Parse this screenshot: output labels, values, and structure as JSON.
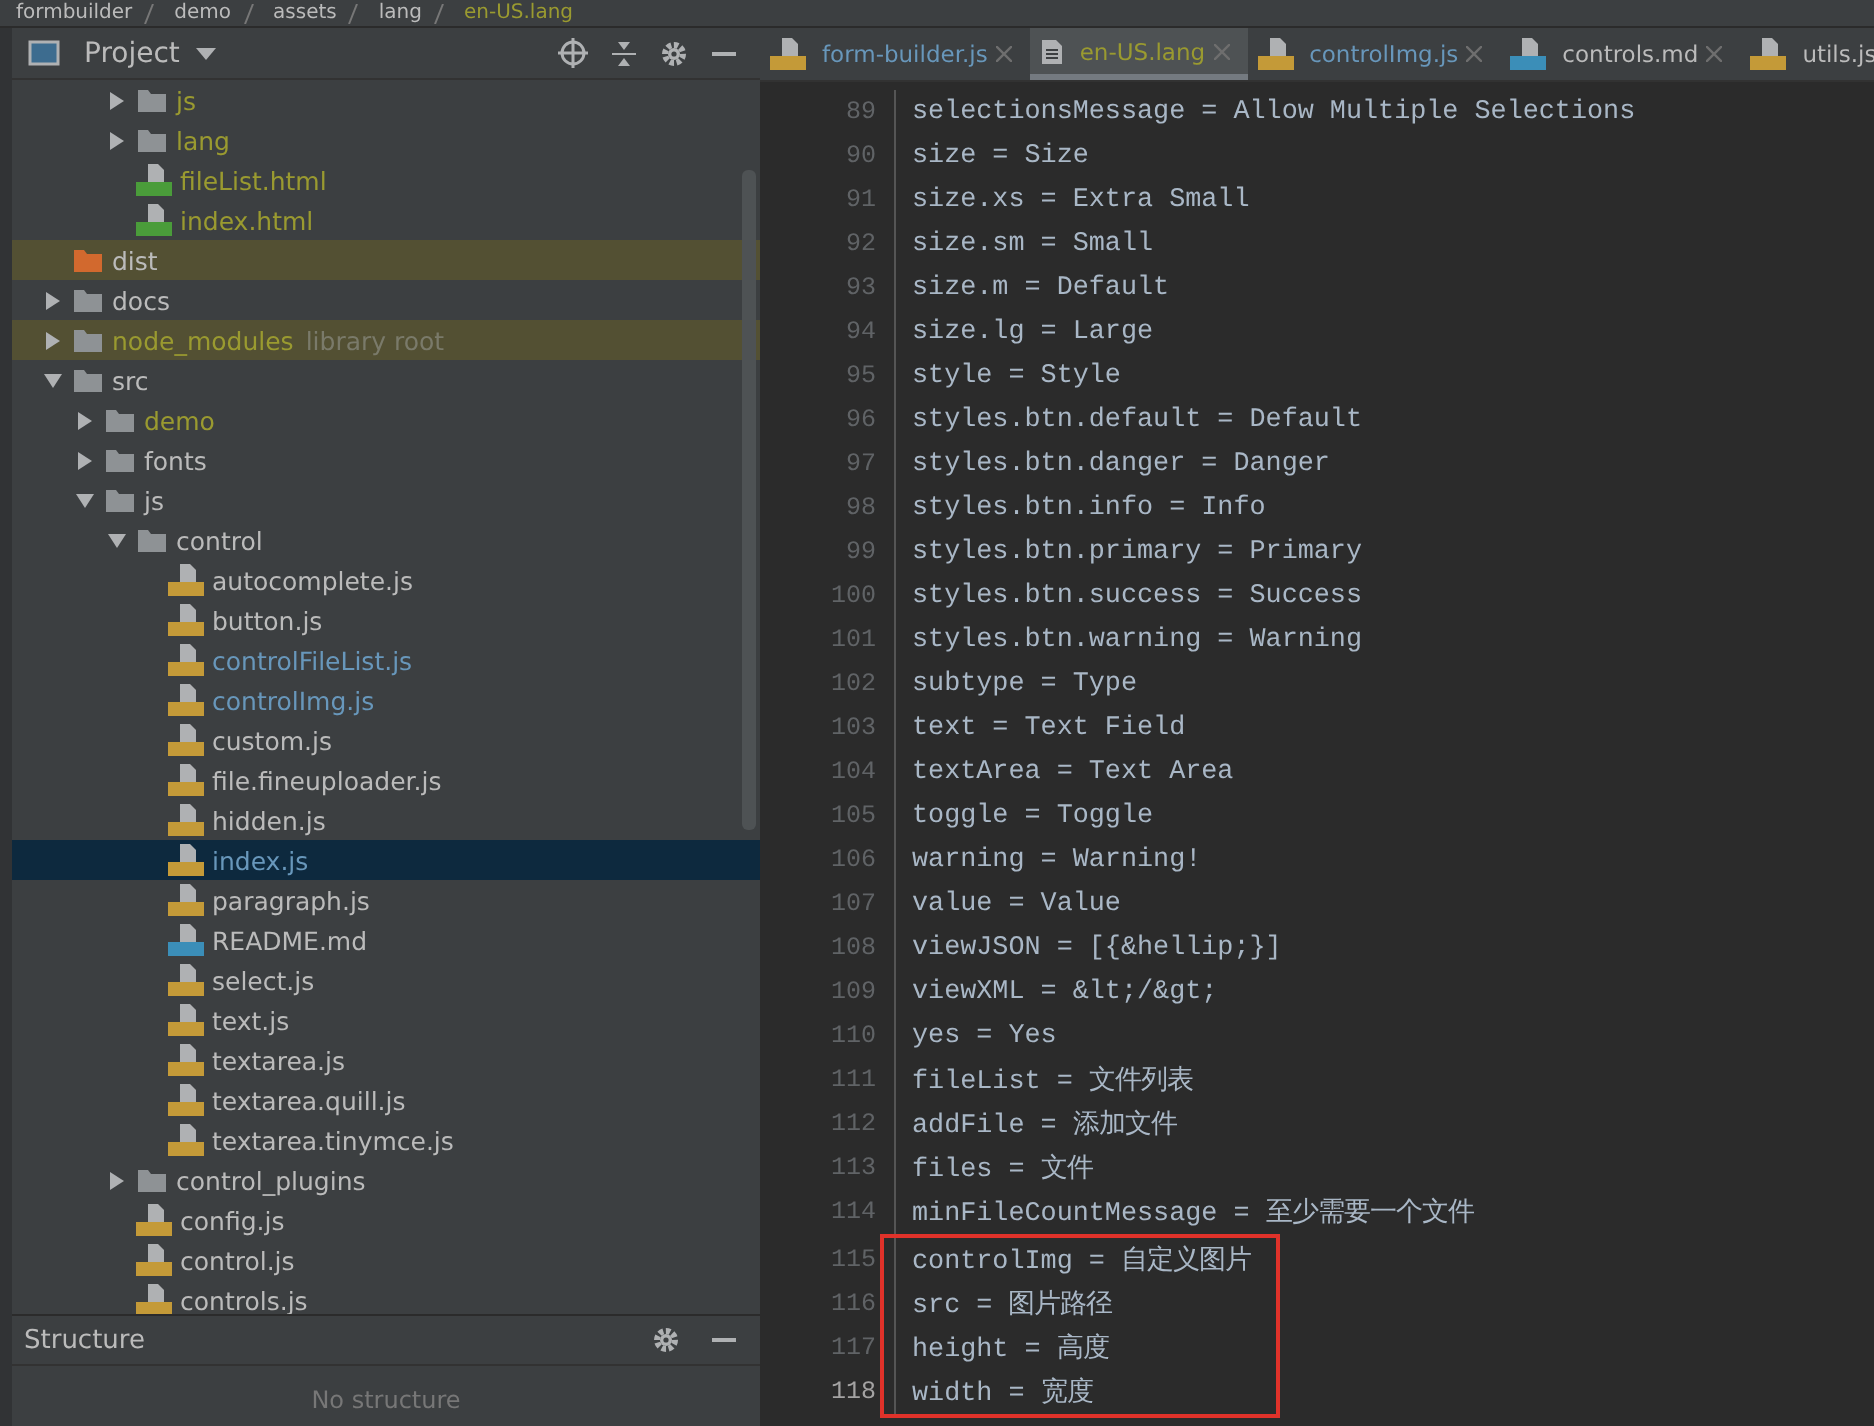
{
  "breadcrumb": [
    "formbuilder",
    "demo",
    "assets",
    "lang",
    "en-US.lang"
  ],
  "project_panel": {
    "title": "Project",
    "tree": {
      "continued_items": [
        {
          "name": "js",
          "kind": "folder",
          "ignored": true,
          "modified": false,
          "excluded": false,
          "expanded": false,
          "selected": false
        },
        {
          "name": "lang",
          "kind": "folder",
          "ignored": true,
          "modified": false,
          "excluded": false,
          "expanded": false,
          "selected": false
        },
        {
          "name": "fileList.html",
          "kind": "html",
          "ignored": true,
          "modified": false,
          "excluded": false,
          "selected": false
        },
        {
          "name": "index.html",
          "kind": "html",
          "ignored": true,
          "modified": false,
          "excluded": false,
          "selected": false
        }
      ],
      "items": [
        {
          "name": "dist",
          "kind": "folder",
          "ignored": false,
          "modified": false,
          "excluded": true,
          "selected": false
        },
        {
          "name": "docs",
          "kind": "folder",
          "ignored": false,
          "modified": false,
          "excluded": false,
          "expanded": false,
          "selected": false
        },
        {
          "name": "node_modules",
          "suffix": "library root",
          "kind": "folder",
          "ignored": true,
          "modified": false,
          "excluded": true,
          "expanded": false,
          "selected": false
        },
        {
          "name": "src",
          "kind": "folder",
          "ignored": false,
          "modified": false,
          "excluded": false,
          "expanded": true,
          "selected": false,
          "children": [
            {
              "name": "demo",
              "kind": "folder",
              "ignored": true,
              "modified": false,
              "excluded": false,
              "expanded": false,
              "selected": false
            },
            {
              "name": "fonts",
              "kind": "folder",
              "ignored": false,
              "modified": false,
              "excluded": false,
              "expanded": false,
              "selected": false
            },
            {
              "name": "js",
              "kind": "folder",
              "ignored": false,
              "modified": false,
              "excluded": false,
              "expanded": true,
              "selected": false,
              "children": [
                {
                  "name": "control",
                  "kind": "folder",
                  "ignored": false,
                  "modified": false,
                  "excluded": false,
                  "expanded": true,
                  "selected": false,
                  "children": [
                    {
                      "name": "autocomplete.js",
                      "kind": "js",
                      "ignored": false,
                      "modified": false,
                      "excluded": false,
                      "selected": false
                    },
                    {
                      "name": "button.js",
                      "kind": "js",
                      "ignored": false,
                      "modified": false,
                      "excluded": false,
                      "selected": false
                    },
                    {
                      "name": "controlFileList.js",
                      "kind": "js",
                      "ignored": false,
                      "modified": true,
                      "excluded": false,
                      "selected": false
                    },
                    {
                      "name": "controlImg.js",
                      "kind": "js",
                      "ignored": false,
                      "modified": true,
                      "excluded": false,
                      "selected": false
                    },
                    {
                      "name": "custom.js",
                      "kind": "js",
                      "ignored": false,
                      "modified": false,
                      "excluded": false,
                      "selected": false
                    },
                    {
                      "name": "file.fineuploader.js",
                      "kind": "js",
                      "ignored": false,
                      "modified": false,
                      "excluded": false,
                      "selected": false
                    },
                    {
                      "name": "hidden.js",
                      "kind": "js",
                      "ignored": false,
                      "modified": false,
                      "excluded": false,
                      "selected": false
                    },
                    {
                      "name": "index.js",
                      "kind": "js",
                      "ignored": false,
                      "modified": true,
                      "excluded": false,
                      "selected": true
                    },
                    {
                      "name": "paragraph.js",
                      "kind": "js",
                      "ignored": false,
                      "modified": false,
                      "excluded": false,
                      "selected": false
                    },
                    {
                      "name": "README.md",
                      "kind": "md",
                      "ignored": false,
                      "modified": false,
                      "excluded": false,
                      "selected": false
                    },
                    {
                      "name": "select.js",
                      "kind": "js",
                      "ignored": false,
                      "modified": false,
                      "excluded": false,
                      "selected": false
                    },
                    {
                      "name": "text.js",
                      "kind": "js",
                      "ignored": false,
                      "modified": false,
                      "excluded": false,
                      "selected": false
                    },
                    {
                      "name": "textarea.js",
                      "kind": "js",
                      "ignored": false,
                      "modified": false,
                      "excluded": false,
                      "selected": false
                    },
                    {
                      "name": "textarea.quill.js",
                      "kind": "js",
                      "ignored": false,
                      "modified": false,
                      "excluded": false,
                      "selected": false
                    },
                    {
                      "name": "textarea.tinymce.js",
                      "kind": "js",
                      "ignored": false,
                      "modified": false,
                      "excluded": false,
                      "selected": false
                    }
                  ]
                },
                {
                  "name": "control_plugins",
                  "kind": "folder",
                  "ignored": false,
                  "modified": false,
                  "excluded": false,
                  "expanded": false,
                  "selected": false
                },
                {
                  "name": "config.js",
                  "kind": "js",
                  "ignored": false,
                  "modified": false,
                  "excluded": false,
                  "selected": false
                },
                {
                  "name": "control.js",
                  "kind": "js",
                  "ignored": false,
                  "modified": false,
                  "excluded": false,
                  "selected": false
                },
                {
                  "name": "controls.js",
                  "kind": "js",
                  "ignored": false,
                  "modified": false,
                  "excluded": false,
                  "selected": false
                }
              ]
            }
          ]
        }
      ]
    }
  },
  "structure_panel": {
    "title": "Structure",
    "message": "No structure"
  },
  "tabs": [
    {
      "label": "form-builder.js",
      "kind": "js",
      "ignored": false,
      "modified": true,
      "selected": false
    },
    {
      "label": "en-US.lang",
      "kind": "text",
      "ignored": true,
      "modified": false,
      "selected": true
    },
    {
      "label": "controlImg.js",
      "kind": "js",
      "ignored": false,
      "modified": true,
      "selected": false
    },
    {
      "label": "controls.md",
      "kind": "md",
      "ignored": false,
      "modified": false,
      "selected": false
    },
    {
      "label": "utils.js",
      "kind": "js",
      "ignored": false,
      "modified": false,
      "selected": false
    }
  ],
  "editor": {
    "lines": [
      {
        "number": "89",
        "text": "selectionsMessage = Allow Multiple Selections",
        "current": false
      },
      {
        "number": "90",
        "text": "size = Size",
        "current": false
      },
      {
        "number": "91",
        "text": "size.xs = Extra Small",
        "current": false
      },
      {
        "number": "92",
        "text": "size.sm = Small",
        "current": false
      },
      {
        "number": "93",
        "text": "size.m = Default",
        "current": false
      },
      {
        "number": "94",
        "text": "size.lg = Large",
        "current": false
      },
      {
        "number": "95",
        "text": "style = Style",
        "current": false
      },
      {
        "number": "96",
        "text": "styles.btn.default = Default",
        "current": false
      },
      {
        "number": "97",
        "text": "styles.btn.danger = Danger",
        "current": false
      },
      {
        "number": "98",
        "text": "styles.btn.info = Info",
        "current": false
      },
      {
        "number": "99",
        "text": "styles.btn.primary = Primary",
        "current": false
      },
      {
        "number": "100",
        "text": "styles.btn.success = Success",
        "current": false
      },
      {
        "number": "101",
        "text": "styles.btn.warning = Warning",
        "current": false
      },
      {
        "number": "102",
        "text": "subtype = Type",
        "current": false
      },
      {
        "number": "103",
        "text": "text = Text Field",
        "current": false
      },
      {
        "number": "104",
        "text": "textArea = Text Area",
        "current": false
      },
      {
        "number": "105",
        "text": "toggle = Toggle",
        "current": false
      },
      {
        "number": "106",
        "text": "warning = Warning!",
        "current": false
      },
      {
        "number": "107",
        "text": "value = Value",
        "current": false
      },
      {
        "number": "108",
        "text": "viewJSON = [{&hellip;}]",
        "current": false
      },
      {
        "number": "109",
        "text": "viewXML = &lt;/&gt;",
        "current": false
      },
      {
        "number": "110",
        "text": "yes = Yes",
        "current": false
      },
      {
        "number": "111",
        "text": "fileList = 文件列表",
        "current": false
      },
      {
        "number": "112",
        "text": "addFile = 添加文件",
        "current": false
      },
      {
        "number": "113",
        "text": "files = 文件",
        "current": false
      },
      {
        "number": "114",
        "text": "minFileCountMessage = 至少需要一个文件",
        "current": false
      }
    ],
    "highlight_box": {
      "lines": [
        {
          "number": "115",
          "text": "controlImg = 自定义图片",
          "current": false
        },
        {
          "number": "116",
          "text": "src = 图片路径",
          "current": false
        },
        {
          "number": "117",
          "text": "height = 高度",
          "current": false
        },
        {
          "number": "118",
          "text": "width = 宽度",
          "current": true
        }
      ]
    }
  }
}
